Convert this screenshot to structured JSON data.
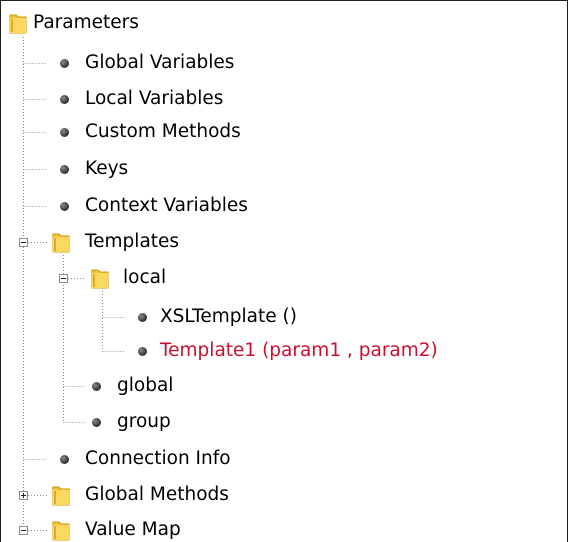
{
  "tree": {
    "root": {
      "label": "Parameters",
      "icon": "folder-icon"
    },
    "global_variables": {
      "label": "Global Variables",
      "icon": "bullet-icon"
    },
    "local_variables": {
      "label": "Local Variables",
      "icon": "bullet-icon"
    },
    "custom_methods": {
      "label": "Custom Methods",
      "icon": "bullet-icon"
    },
    "keys": {
      "label": "Keys",
      "icon": "bullet-icon"
    },
    "context_variables": {
      "label": "Context Variables",
      "icon": "bullet-icon"
    },
    "templates": {
      "label": "Templates",
      "icon": "folder-icon",
      "state": "expanded"
    },
    "local": {
      "label": "local",
      "icon": "folder-icon",
      "state": "expanded"
    },
    "xsl_template": {
      "label": "XSLTemplate ()",
      "icon": "bullet-icon"
    },
    "template1": {
      "label": "Template1 (param1 , param2)",
      "icon": "bullet-icon",
      "color": "#c8102e"
    },
    "global": {
      "label": "global",
      "icon": "bullet-icon"
    },
    "group": {
      "label": "group",
      "icon": "bullet-icon"
    },
    "connection_info": {
      "label": "Connection Info",
      "icon": "bullet-icon"
    },
    "global_methods": {
      "label": "Global Methods",
      "icon": "folder-icon",
      "state": "collapsed"
    },
    "value_map": {
      "label": "Value Map",
      "icon": "folder-icon",
      "state": "expanded"
    }
  },
  "colors": {
    "folder": "#f4c430",
    "folder_dark": "#c89a10",
    "highlight_text": "#c8102e",
    "connector": "#8c8c8c"
  }
}
